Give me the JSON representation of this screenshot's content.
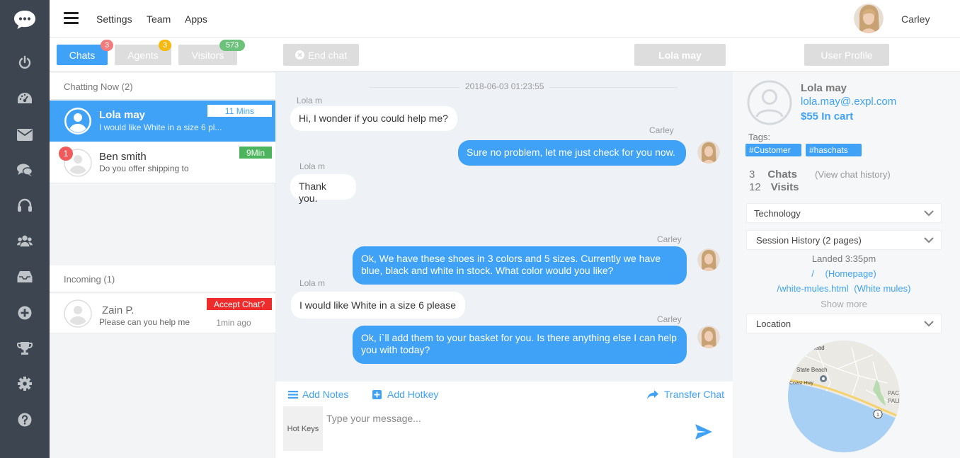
{
  "nav": {
    "menu_items": [
      "Settings",
      "Team",
      "Apps"
    ],
    "user_name": "Carley"
  },
  "sidebar_icons": [
    "power-icon",
    "dashboard-icon",
    "mail-icon",
    "chats-icon",
    "headset-icon",
    "team-icon",
    "inbox-icon",
    "add-icon",
    "trophy-icon",
    "settings-icon",
    "help-icon"
  ],
  "tabs": [
    {
      "label": "Chats",
      "badge": "3",
      "active": true
    },
    {
      "label": "Agents",
      "badge": "3",
      "active": false
    },
    {
      "label": "Visitors",
      "badge": "573",
      "active": false
    }
  ],
  "chatting_now": {
    "header": "Chatting Now",
    "count": "(2)",
    "items": [
      {
        "name": "Lola may",
        "preview": "I would like White in a size 6 pl...",
        "time": "11 Mins",
        "active": true
      },
      {
        "name": "Ben smith",
        "preview": "Do you offer shipping to",
        "time": "9Min",
        "unread": "1"
      }
    ]
  },
  "incoming": {
    "header": "Incoming",
    "count": "(1)",
    "items": [
      {
        "name": "Zain P.",
        "preview": "Please can you help me",
        "action": "Accept Chat?",
        "time": "1min ago"
      }
    ]
  },
  "conversation": {
    "end_chat_label": "End chat",
    "visitor_name": "Lola may",
    "date": "2018-06-03 01:23:55",
    "messages": [
      {
        "sender": "Lola m",
        "text": "Hi, I wonder if you could help me?",
        "direction": "in"
      },
      {
        "sender": "Carley",
        "text": "Sure no problem, let me just check for you now.",
        "direction": "out"
      },
      {
        "sender": "Lola m",
        "text": "Thank you.",
        "direction": "in"
      },
      {
        "sender": "Carley",
        "text": "Ok, We have these shoes in 3 colors and 5 sizes. Currently we have blue, black and white in stock. What color would you like?",
        "direction": "out"
      },
      {
        "sender": "Lola m",
        "text": "I would like White in a size 6 please",
        "direction": "in"
      },
      {
        "sender": "Carley",
        "text": "Ok, i`ll add them to your basket for you. Is there anything else I can help you with today?",
        "direction": "out"
      }
    ]
  },
  "composer": {
    "add_notes": "Add Notes",
    "add_hotkey": "Add Hotkey",
    "transfer_chat": "Transfer Chat",
    "hot_keys": "Hot Keys",
    "placeholder": "Type your message..."
  },
  "profile": {
    "button_label": "User Profile",
    "name": "Lola may",
    "email": "lola.may@.expl.com",
    "cart_amount": "$55",
    "cart_label": "In cart",
    "tags_label": "Tags:",
    "tags": [
      "#Customer",
      "#haschats"
    ],
    "chats_count": "3",
    "chats_label": "Chats",
    "visits_count": "12",
    "visits_label": "Visits",
    "view_history": "(View chat history)",
    "technology_label": "Technology",
    "session_history_label": "Session History (2 pages)",
    "landed": "Landed 3:35pm",
    "pages": [
      {
        "path": "/",
        "title": "(Homepage)"
      },
      {
        "path": "/white-mules.html",
        "title": "(White mules)"
      }
    ],
    "show_more": "Show more",
    "location_label": "Location",
    "map_labels": [
      "ihead",
      "State Beach",
      "Coast Hwy",
      "PAC",
      "PALI",
      "1"
    ]
  },
  "colors": {
    "accent": "#3fa2f7",
    "sidebar": "#3d4650",
    "danger": "#ee2c2c",
    "success": "#4cb45c",
    "warning": "#f6b90f",
    "badge_red": "#f27b7b",
    "badge_green": "#6cc27b"
  }
}
